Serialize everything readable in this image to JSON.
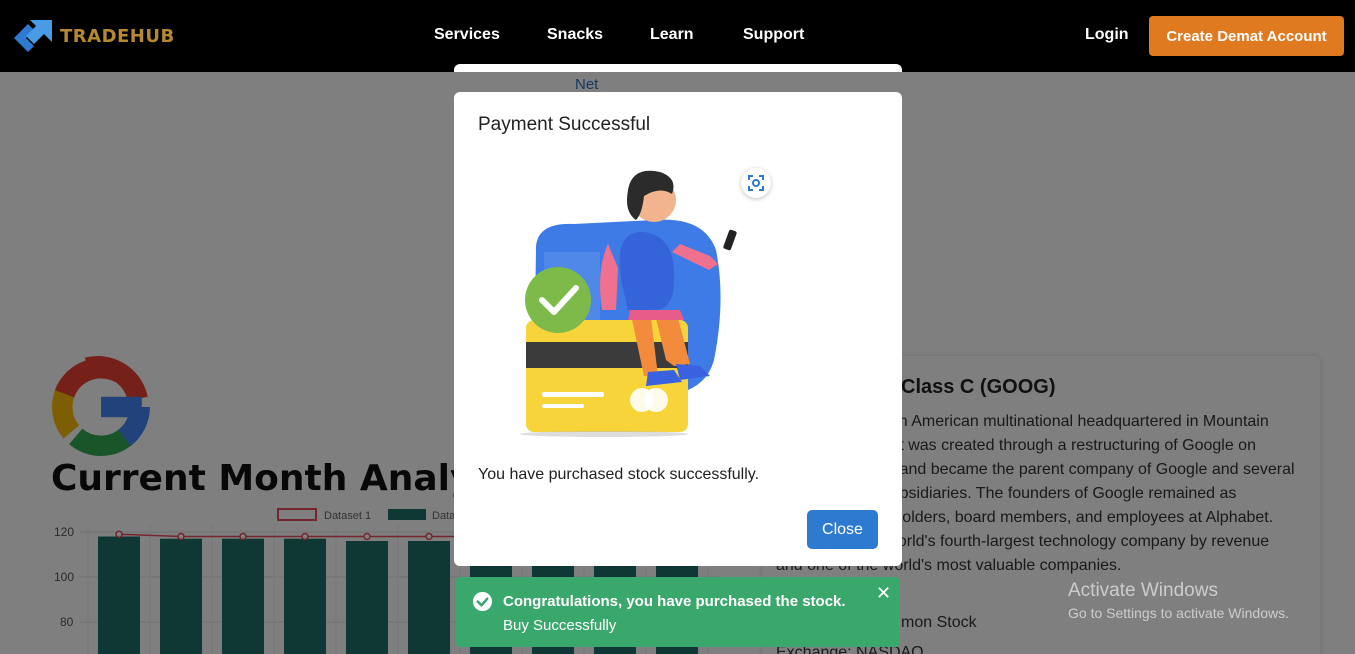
{
  "navbar": {
    "brand": "TRADEHUB",
    "links": [
      "Services",
      "Snacks",
      "Learn",
      "Support"
    ],
    "login": "Login",
    "cta": "Create Demat Account",
    "colors": {
      "background": "#000000",
      "brand": "#b5892d",
      "cta": "#e07a20"
    }
  },
  "background_page": {
    "analysis_title": "Current Month Analysis",
    "chart_legend": [
      "Dataset 1",
      "Data"
    ],
    "chart_y_ticks": [
      "120",
      "100",
      "80"
    ],
    "info_title": "Class C (GOOG)",
    "info_description": "Alphabet Inc. is an American multinational headquartered in Mountain View, California. It was created through a restructuring of Google on October 2, 2015, and became the parent company of Google and several former Google subsidiaries. The founders of Google remained as controlling shareholders, board members, and employees at Alphabet. Alphabet is the world's fourth-largest technology company by revenue and one of the world's most valuable companies.",
    "info_line1": "mon Stock",
    "info_line2": "Exchange: NASDAQ",
    "behind_modal_text": "Net"
  },
  "modal": {
    "title": "Payment Successful",
    "message": "You have purchased stock successfully.",
    "close_label": "Close",
    "accent": "#2e7ad1"
  },
  "toast": {
    "title": "Congratulations, you have purchased the stock.",
    "message": "Buy Successfully",
    "background": "#3aa76d"
  },
  "watermark": {
    "title": "Activate Windows",
    "subtitle": "Go to Settings to activate Windows."
  },
  "chart_data": {
    "type": "bar",
    "legend": [
      "Dataset 1",
      "Data"
    ],
    "ylim": [
      70,
      125
    ],
    "values": [
      118,
      117,
      117,
      117,
      116,
      116,
      116,
      116,
      116,
      116
    ],
    "line": [
      119,
      118,
      118,
      118,
      118,
      118,
      118,
      118,
      118,
      118
    ]
  }
}
